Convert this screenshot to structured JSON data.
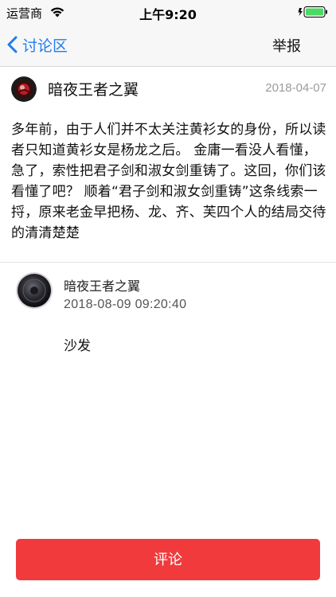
{
  "status_bar": {
    "carrier": "运营商",
    "time": "上午9:20",
    "icons": [
      "wifi-icon",
      "battery-icon"
    ]
  },
  "nav": {
    "back_label": "讨论区",
    "report_label": "举报",
    "accent_color": "#1e7cf2"
  },
  "post": {
    "author": "暗夜王者之翼",
    "date": "2018-04-07",
    "body": "多年前，由于人们并不太关注黄衫女的身份，所以读者只知道黄衫女是杨龙之后。 金庸一看没人看懂，急了，索性把君子剑和淑女剑重铸了。这回，你们该看懂了吧？ 顺着“君子剑和淑女剑重铸”这条线索一捋，原来老金早把杨、龙、齐、芙四个人的结局交待的清清楚楚"
  },
  "comment": {
    "author": "暗夜王者之翼",
    "time": "2018-08-09 09:20:40",
    "text": "沙发"
  },
  "footer": {
    "comment_button_label": "评论",
    "button_color": "#f03a3c"
  }
}
